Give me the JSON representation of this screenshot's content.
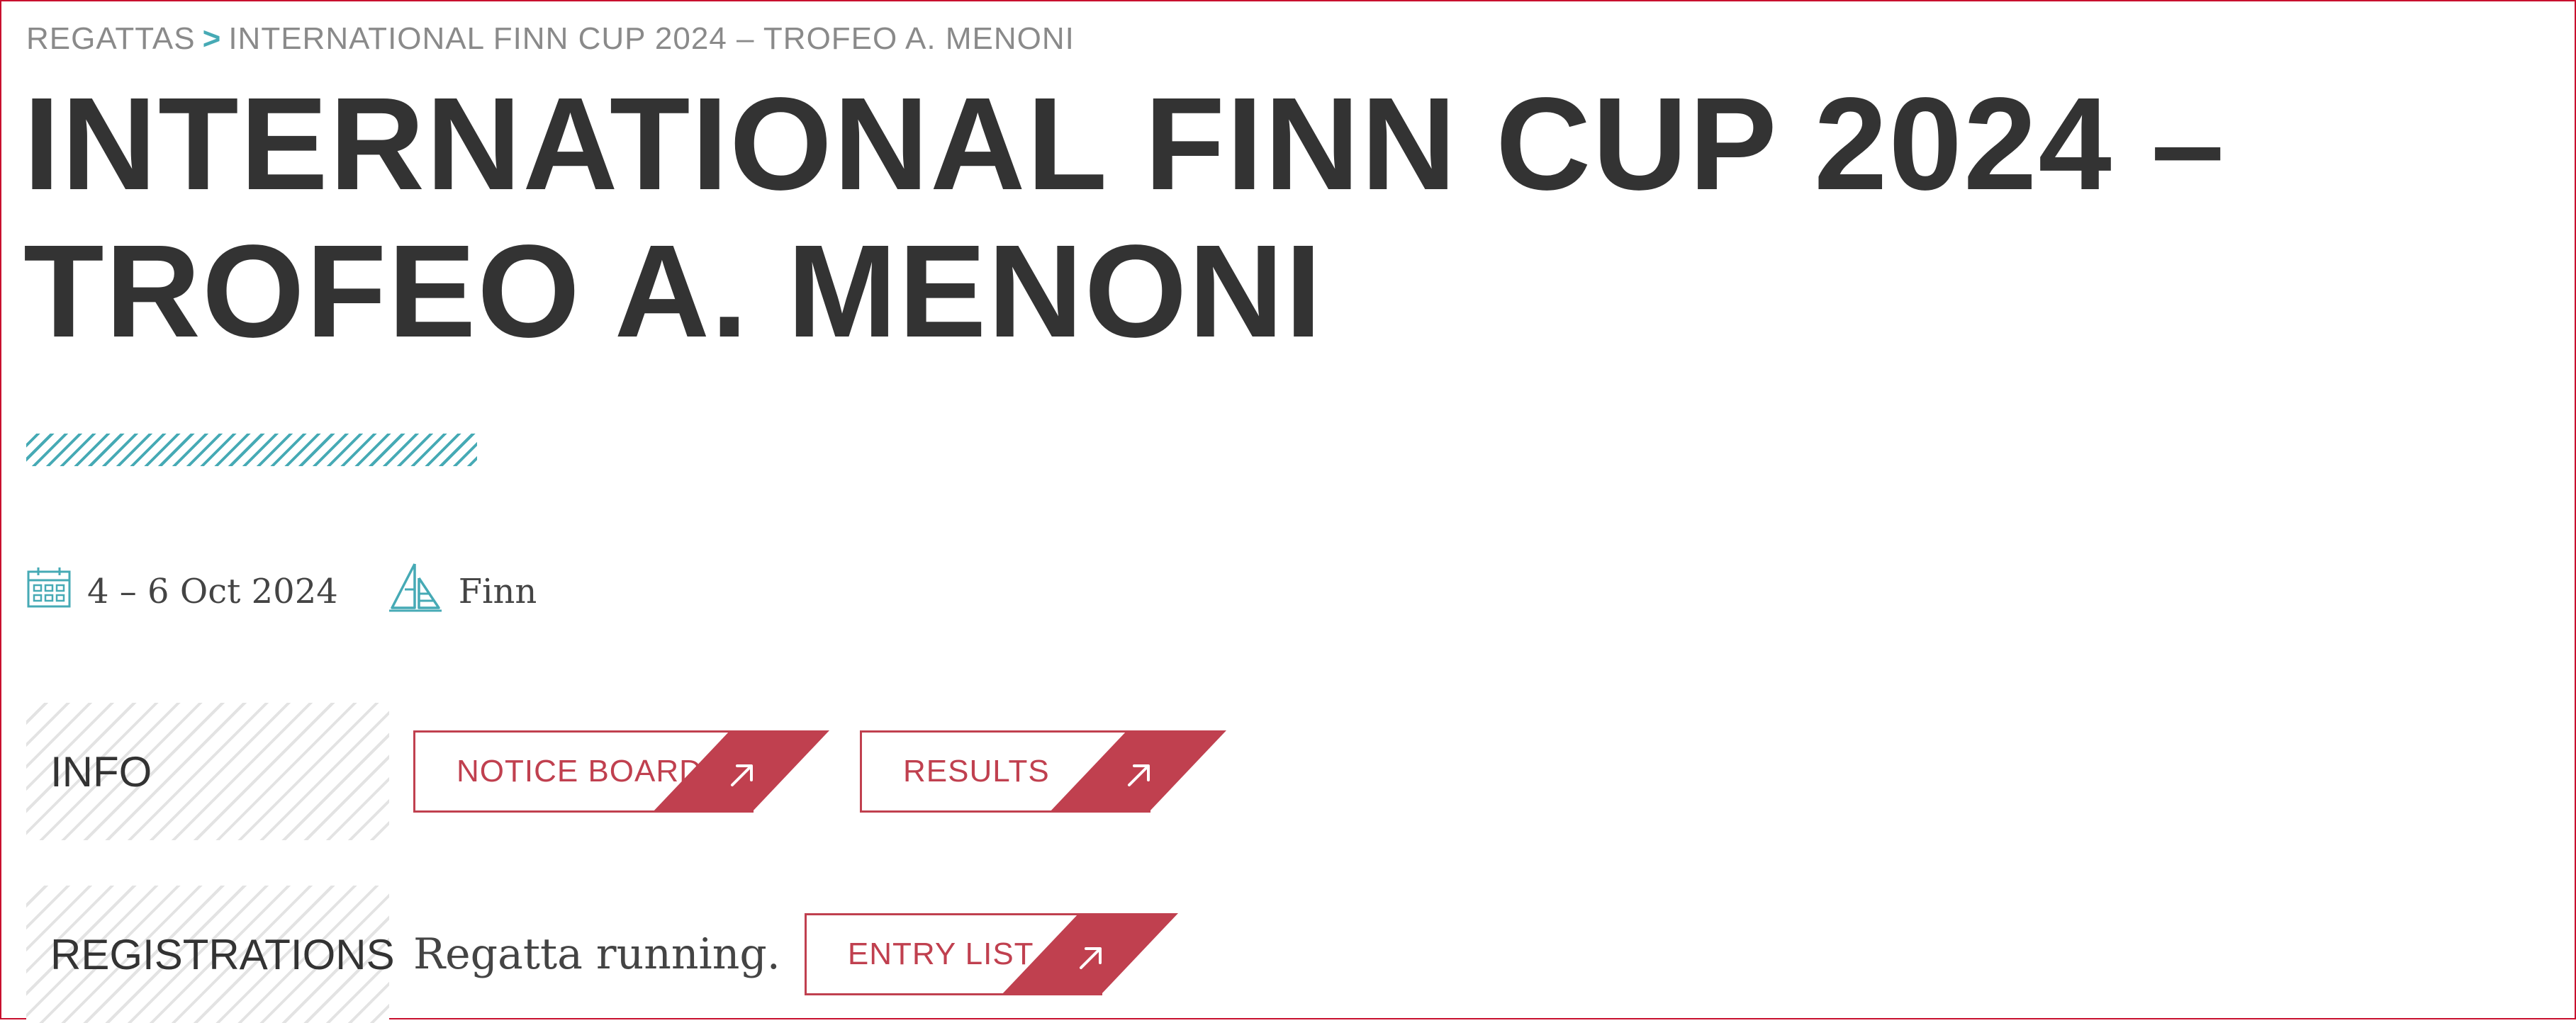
{
  "breadcrumb": {
    "root": "REGATTAS",
    "separator": ">",
    "current": "INTERNATIONAL FINN CUP 2024 – TROFEO A. MENONI"
  },
  "title": "INTERNATIONAL FINN CUP 2024 – TROFEO A. MENONI",
  "meta": {
    "dates": "4 – 6 Oct 2024",
    "dates_icon": "calendar-icon",
    "boat_class": "Finn",
    "boat_class_icon": "sailboat-icon"
  },
  "info": {
    "label": "INFO",
    "buttons": [
      {
        "label": "NOTICE BOARD",
        "icon": "arrow-up-right-icon"
      },
      {
        "label": "RESULTS",
        "icon": "arrow-up-right-icon"
      }
    ]
  },
  "registrations": {
    "label": "REGISTRATIONS",
    "status": "Regatta running.",
    "button": {
      "label": "ENTRY LIST",
      "icon": "arrow-up-right-icon"
    }
  },
  "colors": {
    "accent": "#c0404f",
    "teal": "#46aab5",
    "text": "#333333",
    "muted": "#8a8a8a"
  }
}
